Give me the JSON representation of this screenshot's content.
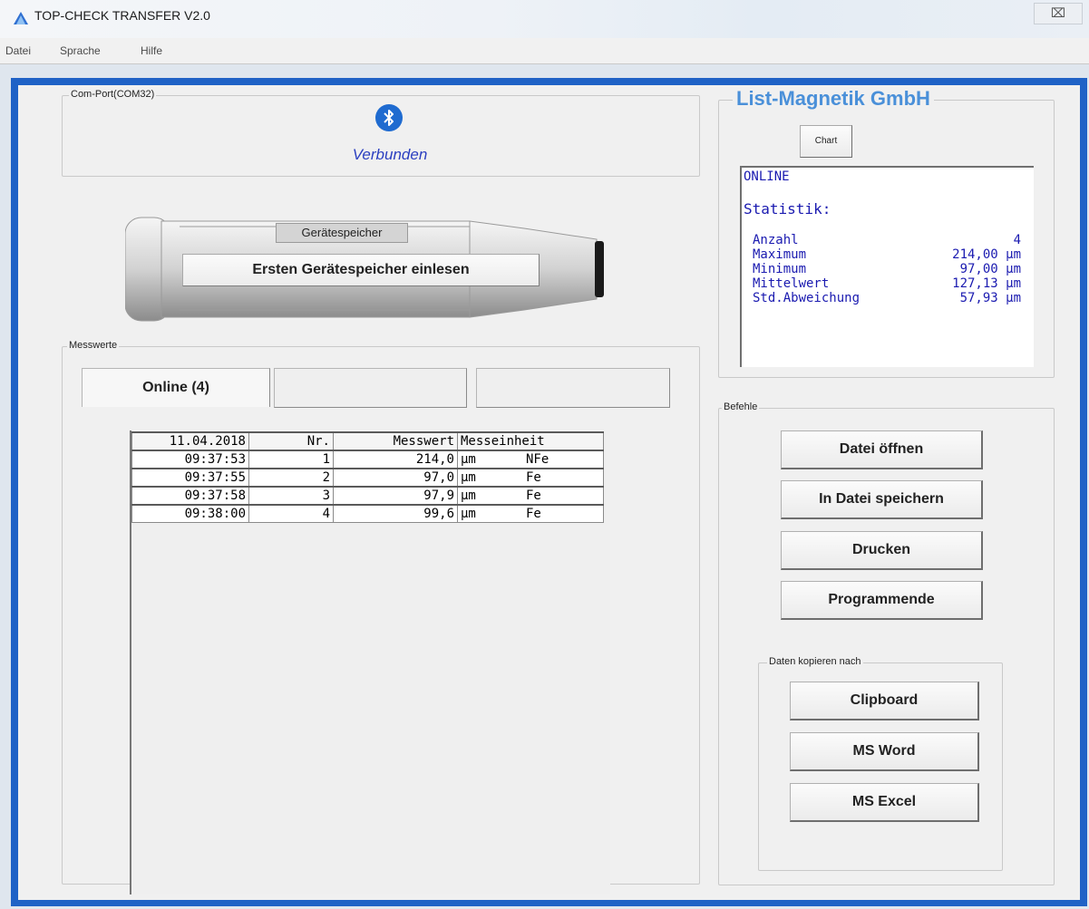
{
  "window": {
    "title": "TOP-CHECK TRANSFER V2.0",
    "close_glyph": "⌧"
  },
  "menu": [
    "Datei",
    "Sprache",
    "Hilfe"
  ],
  "com_port": {
    "label": "Com-Port(COM32)",
    "status": "Verbunden"
  },
  "device": {
    "label": "Gerätespeicher",
    "read_button": "Ersten Gerätespeicher einlesen"
  },
  "measurements": {
    "label": "Messwerte",
    "tabs": [
      "Online (4)",
      "",
      ""
    ],
    "header": [
      "11.04.2018",
      "Nr.",
      "Messwert",
      "Messeinheit"
    ],
    "rows": [
      {
        "time": "09:37:53",
        "nr": "1",
        "value": "214,0",
        "unit": "µm",
        "type": "NFe"
      },
      {
        "time": "09:37:55",
        "nr": "2",
        "value": "97,0",
        "unit": "µm",
        "type": "Fe"
      },
      {
        "time": "09:37:58",
        "nr": "3",
        "value": "97,9",
        "unit": "µm",
        "type": "Fe"
      },
      {
        "time": "09:38:00",
        "nr": "4",
        "value": "99,6",
        "unit": "µm",
        "type": "Fe"
      }
    ]
  },
  "brand": "List-Magnetik GmbH",
  "chart_button": "Chart",
  "stats": {
    "mode": "ONLINE",
    "heading": "Statistik:",
    "items": [
      {
        "label": "Anzahl",
        "value": "4"
      },
      {
        "label": "Maximum",
        "value": "214,00 µm"
      },
      {
        "label": "Minimum",
        "value": "97,00 µm"
      },
      {
        "label": "Mittelwert",
        "value": "127,13 µm"
      },
      {
        "label": "Std.Abweichung",
        "value": "57,93 µm"
      }
    ]
  },
  "commands": {
    "label": "Befehle",
    "open": "Datei öffnen",
    "save": "In Datei speichern",
    "print": "Drucken",
    "quit": "Programmende"
  },
  "copy": {
    "label": "Daten kopieren nach",
    "clipboard": "Clipboard",
    "word": "MS Word",
    "excel": "MS Excel"
  },
  "colors": {
    "frame": "#1f62c6",
    "brand": "#4a90d9",
    "stats_text": "#1a1ab0",
    "status_text": "#2b3fc0"
  }
}
